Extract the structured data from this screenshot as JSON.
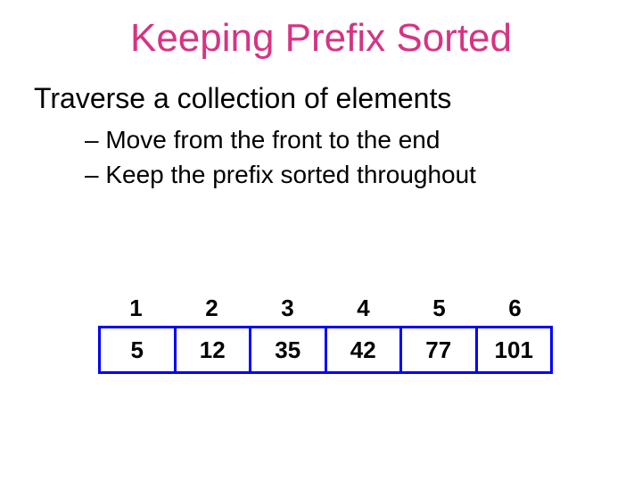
{
  "title": "Keeping Prefix Sorted",
  "subtitle": "Traverse a collection of elements",
  "bullets": [
    "– Move from the front to the end",
    "– Keep the prefix sorted throughout"
  ],
  "array": {
    "indices": [
      "1",
      "2",
      "3",
      "4",
      "5",
      "6"
    ],
    "values": [
      "5",
      "12",
      "35",
      "42",
      "77",
      "101"
    ]
  }
}
